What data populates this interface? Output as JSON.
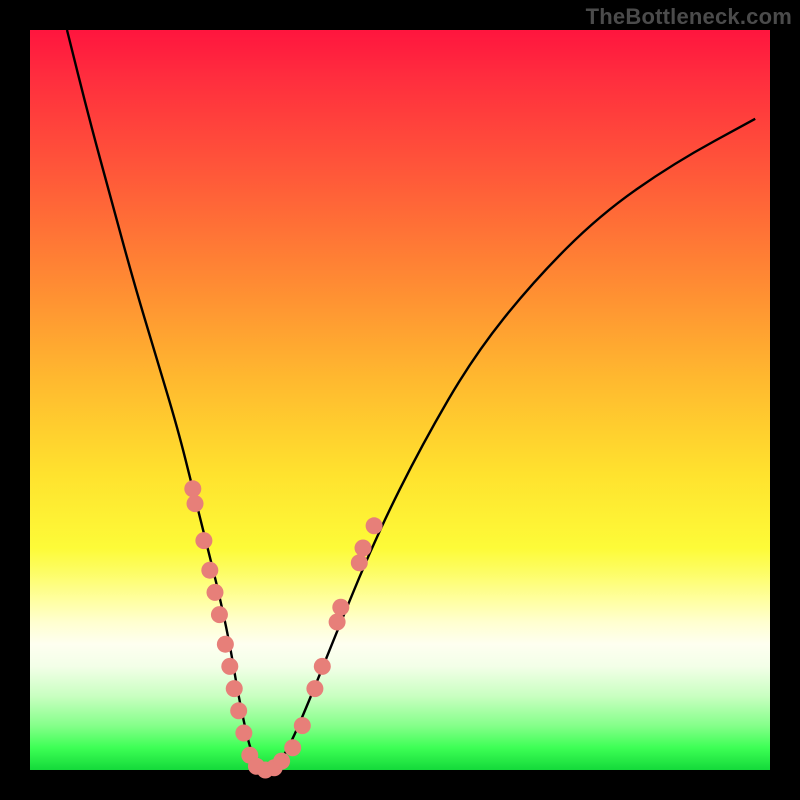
{
  "watermark": "TheBottleneck.com",
  "colors": {
    "frame": "#000000",
    "curve_stroke": "#000000",
    "marker_fill": "#e77f79",
    "marker_stroke": "#e06060"
  },
  "chart_data": {
    "type": "line",
    "title": "",
    "xlabel": "",
    "ylabel": "",
    "xlim": [
      0,
      100
    ],
    "ylim": [
      0,
      100
    ],
    "grid": false,
    "legend": null,
    "series": [
      {
        "name": "curve",
        "x": [
          5,
          8,
          11,
          14,
          17,
          20,
          22,
          24,
          25.5,
          27,
          28,
          29,
          30,
          31.5,
          33,
          35,
          38,
          42,
          47,
          53,
          60,
          68,
          77,
          87,
          98
        ],
        "y": [
          100,
          88,
          77,
          66,
          56,
          46,
          38,
          30,
          24,
          17,
          11,
          6,
          2,
          0,
          0,
          3,
          10,
          20,
          32,
          44,
          56,
          66,
          75,
          82,
          88
        ]
      }
    ],
    "markers": [
      {
        "x": 22.0,
        "y": 38
      },
      {
        "x": 22.3,
        "y": 36
      },
      {
        "x": 23.5,
        "y": 31
      },
      {
        "x": 24.3,
        "y": 27
      },
      {
        "x": 25.0,
        "y": 24
      },
      {
        "x": 25.6,
        "y": 21
      },
      {
        "x": 26.4,
        "y": 17
      },
      {
        "x": 27.0,
        "y": 14
      },
      {
        "x": 27.6,
        "y": 11
      },
      {
        "x": 28.2,
        "y": 8
      },
      {
        "x": 28.9,
        "y": 5
      },
      {
        "x": 29.7,
        "y": 2
      },
      {
        "x": 30.6,
        "y": 0.5
      },
      {
        "x": 31.8,
        "y": 0
      },
      {
        "x": 33.0,
        "y": 0.3
      },
      {
        "x": 34.0,
        "y": 1.2
      },
      {
        "x": 35.5,
        "y": 3
      },
      {
        "x": 36.8,
        "y": 6
      },
      {
        "x": 38.5,
        "y": 11
      },
      {
        "x": 39.5,
        "y": 14
      },
      {
        "x": 41.5,
        "y": 20
      },
      {
        "x": 42.0,
        "y": 22
      },
      {
        "x": 44.5,
        "y": 28
      },
      {
        "x": 45.0,
        "y": 30
      },
      {
        "x": 46.5,
        "y": 33
      }
    ]
  }
}
